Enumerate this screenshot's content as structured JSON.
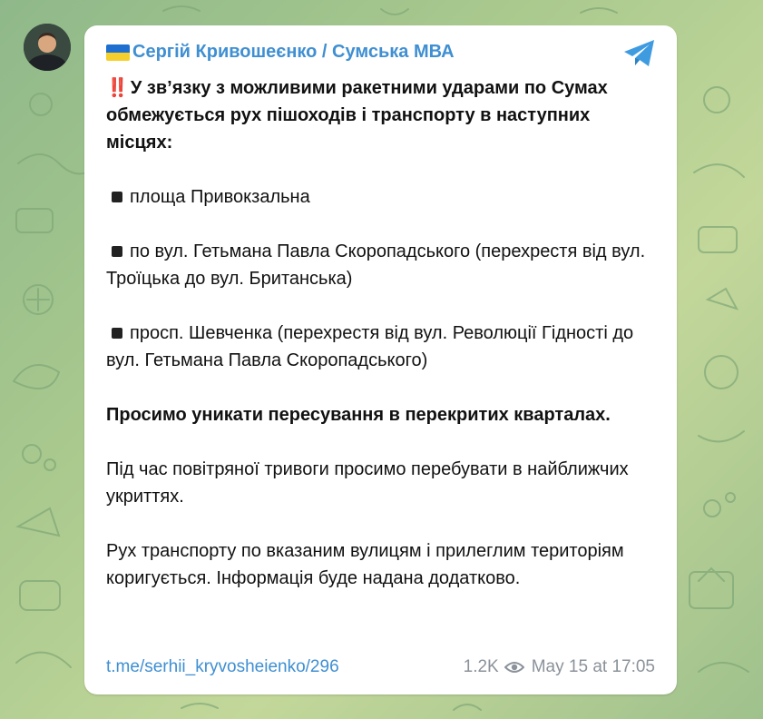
{
  "channel": {
    "title": "Сергій Кривошеєнко / Сумська МВА",
    "flag_colors": [
      "#1f6fd0",
      "#f5d02c"
    ],
    "logo": "telegram-plane-icon",
    "avatar": "channel-avatar-photo"
  },
  "message": {
    "alert": "‼️",
    "intro": "У зв’язку з можливими ракетними ударами по Сумах обмежується рух пішоходів і транспорту в наступних місцях:",
    "bullet_icon": "black-square-icon",
    "places": [
      "площа Привокзальна",
      "по вул. Гетьмана Павла Скоропадського (перехрестя від вул. Троїцька до вул. Британська)",
      "просп. Шевченка (перехрестя від вул. Революції Гідності до вул. Гетьмана Павла Скоропадського)"
    ],
    "request": "Просимо уникати пересування в перекритих кварталах.",
    "alarm_note": "Під час повітряної тривоги просимо перебувати в найближчих укриттях.",
    "traffic_note": "Рух транспорту по вказаним вулицям і прилеглим територіям коригується. Інформація буде надана додатково."
  },
  "footer": {
    "link": "t.me/serhii_kryvosheienko/296",
    "views": "1.2K",
    "views_icon": "eye-icon",
    "timestamp": "May 15 at 17:05"
  },
  "colors": {
    "accent": "#3f8fd2",
    "alert_red": "#d63a2a",
    "meta_gray": "#8b929a"
  }
}
